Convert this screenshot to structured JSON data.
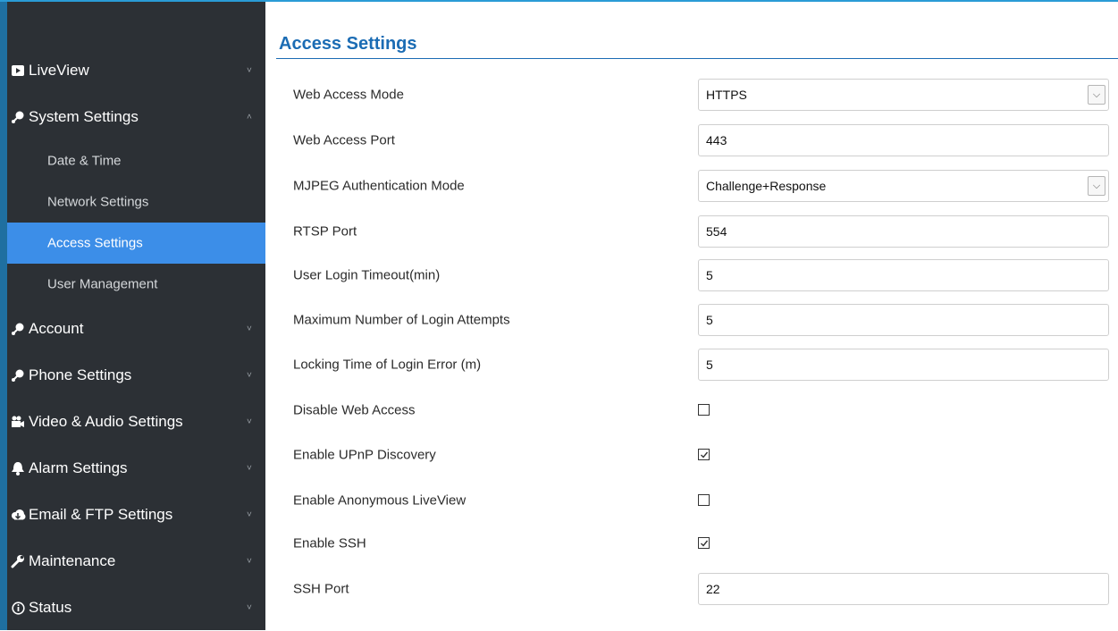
{
  "sidebar": {
    "items": [
      {
        "label": "LiveView",
        "icon": "play-icon",
        "chevron": "˅"
      },
      {
        "label": "System Settings",
        "icon": "gear-icon",
        "chevron": "˄"
      },
      {
        "label": "Account",
        "icon": "gear-icon",
        "chevron": "˅"
      },
      {
        "label": "Phone Settings",
        "icon": "gear-icon",
        "chevron": "˅"
      },
      {
        "label": "Video & Audio Settings",
        "icon": "video-camera-icon",
        "chevron": "˅"
      },
      {
        "label": "Alarm Settings",
        "icon": "bell-icon",
        "chevron": "˅"
      },
      {
        "label": "Email & FTP Settings",
        "icon": "cloud-icon",
        "chevron": "˅"
      },
      {
        "label": "Maintenance",
        "icon": "wrench-icon",
        "chevron": "˅"
      },
      {
        "label": "Status",
        "icon": "info-icon",
        "chevron": "˅"
      }
    ],
    "subitems": [
      {
        "label": "Date & Time"
      },
      {
        "label": "Network Settings"
      },
      {
        "label": "Access Settings",
        "active": true
      },
      {
        "label": "User Management"
      }
    ]
  },
  "page": {
    "title": "Access Settings"
  },
  "form": [
    {
      "label": "Web Access Mode",
      "type": "select",
      "value": "HTTPS"
    },
    {
      "label": "Web Access Port",
      "type": "input",
      "value": "443"
    },
    {
      "label": "MJPEG Authentication Mode",
      "type": "select",
      "value": "Challenge+Response"
    },
    {
      "label": "RTSP Port",
      "type": "input",
      "value": "554"
    },
    {
      "label": "User Login Timeout(min)",
      "type": "input",
      "value": "5"
    },
    {
      "label": "Maximum Number of Login Attempts",
      "type": "input",
      "value": "5"
    },
    {
      "label": "Locking Time of Login Error (m)",
      "type": "input",
      "value": "5"
    },
    {
      "label": "Disable Web Access",
      "type": "checkbox",
      "checked": false
    },
    {
      "label": "Enable UPnP Discovery",
      "type": "checkbox",
      "checked": true
    },
    {
      "label": "Enable Anonymous LiveView",
      "type": "checkbox",
      "checked": false
    },
    {
      "label": "Enable SSH",
      "type": "checkbox",
      "checked": true
    },
    {
      "label": "SSH Port",
      "type": "input",
      "value": "22"
    }
  ],
  "colors": {
    "accent": "#1b6cb4",
    "sidebar_bg": "#2c3035",
    "active_bg": "#3c8ee8"
  }
}
